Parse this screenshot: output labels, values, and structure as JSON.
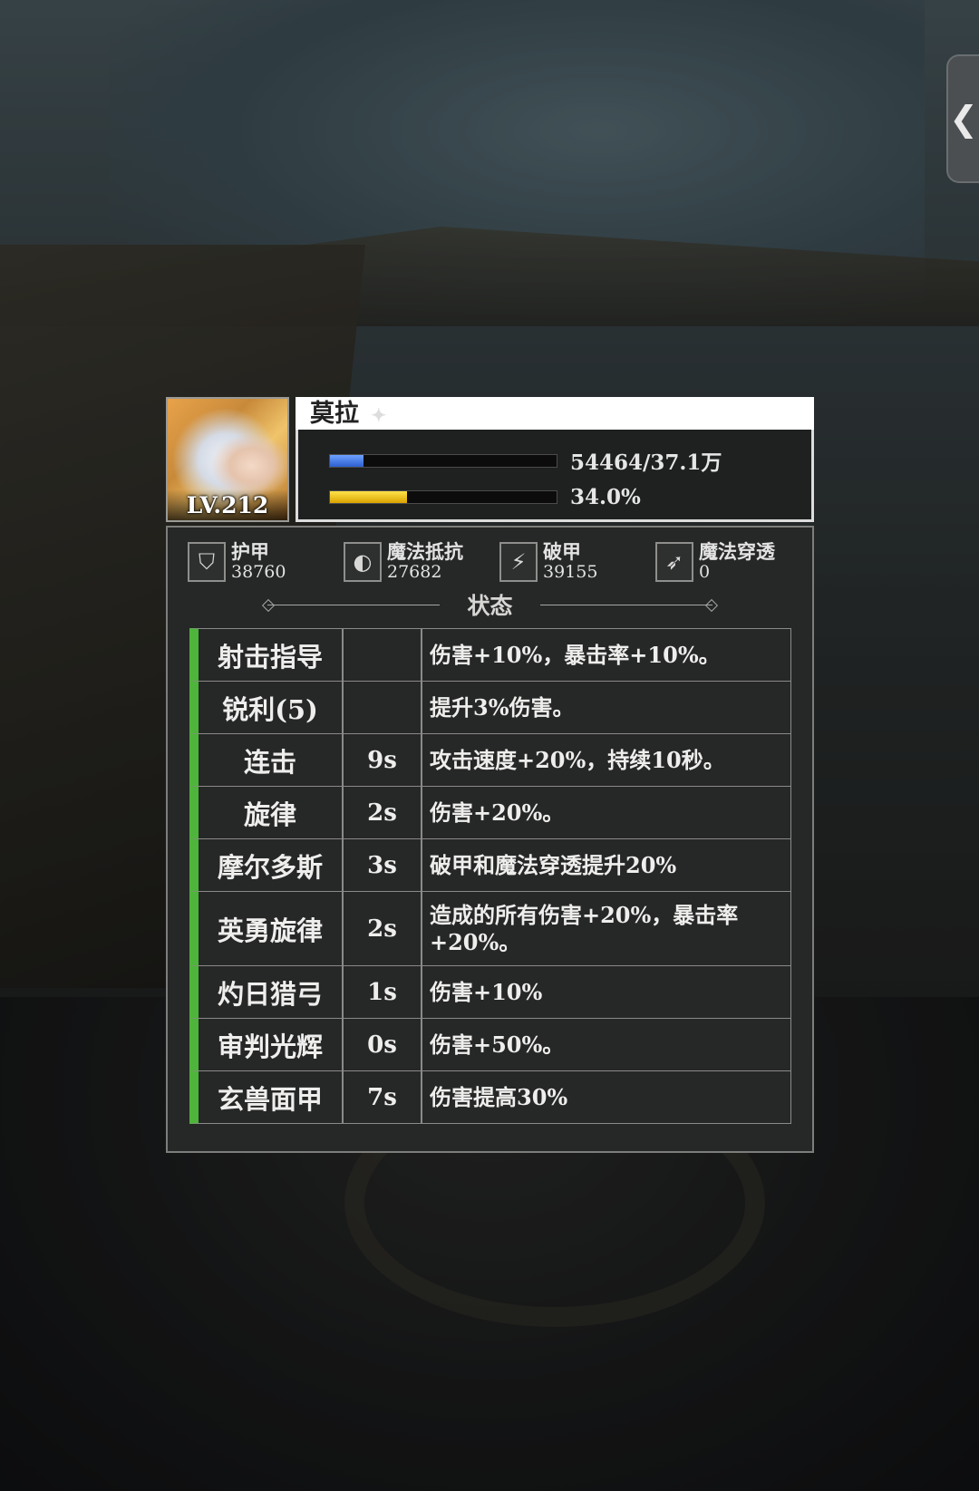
{
  "hero": {
    "name": "莫拉",
    "level": "LV.212",
    "hp_text": "54464/37.1万",
    "hp_fraction": 0.147,
    "energy_text": "34.0%",
    "energy_fraction": 0.34
  },
  "stats": [
    {
      "label": "护甲",
      "value": "38760",
      "icon": "armor-shield-icon"
    },
    {
      "label": "魔法抵抗",
      "value": "27682",
      "icon": "magic-resist-icon"
    },
    {
      "label": "破甲",
      "value": "39155",
      "icon": "armor-break-icon"
    },
    {
      "label": "魔法穿透",
      "value": "0",
      "icon": "magic-penetration-icon"
    }
  ],
  "status_title": "状态",
  "status_rows": [
    {
      "name": "射击指导",
      "duration": "",
      "desc": "伤害+10%，暴击率+10%。"
    },
    {
      "name": "锐利(5)",
      "duration": "",
      "desc": "提升3%伤害。"
    },
    {
      "name": "连击",
      "duration": "9s",
      "desc": "攻击速度+20%，持续10秒。"
    },
    {
      "name": "旋律",
      "duration": "2s",
      "desc": "伤害+20%。"
    },
    {
      "name": "摩尔多斯",
      "duration": "3s",
      "desc": "破甲和魔法穿透提升20%"
    },
    {
      "name": "英勇旋律",
      "duration": "2s",
      "desc": "造成的所有伤害+20%，暴击率+20%。"
    },
    {
      "name": "灼日猎弓",
      "duration": "1s",
      "desc": "伤害+10%"
    },
    {
      "name": "审判光辉",
      "duration": "0s",
      "desc": "伤害+50%。"
    },
    {
      "name": "玄兽面甲",
      "duration": "7s",
      "desc": "伤害提高30%"
    }
  ],
  "side_tab": {
    "icon": "chevron-left-icon",
    "glyph": "❮"
  },
  "colors": {
    "hp_bar": "#3f74e6",
    "energy_bar": "#f2c21a",
    "status_accent": "#4fb43b",
    "panel_bg": "#262727"
  }
}
